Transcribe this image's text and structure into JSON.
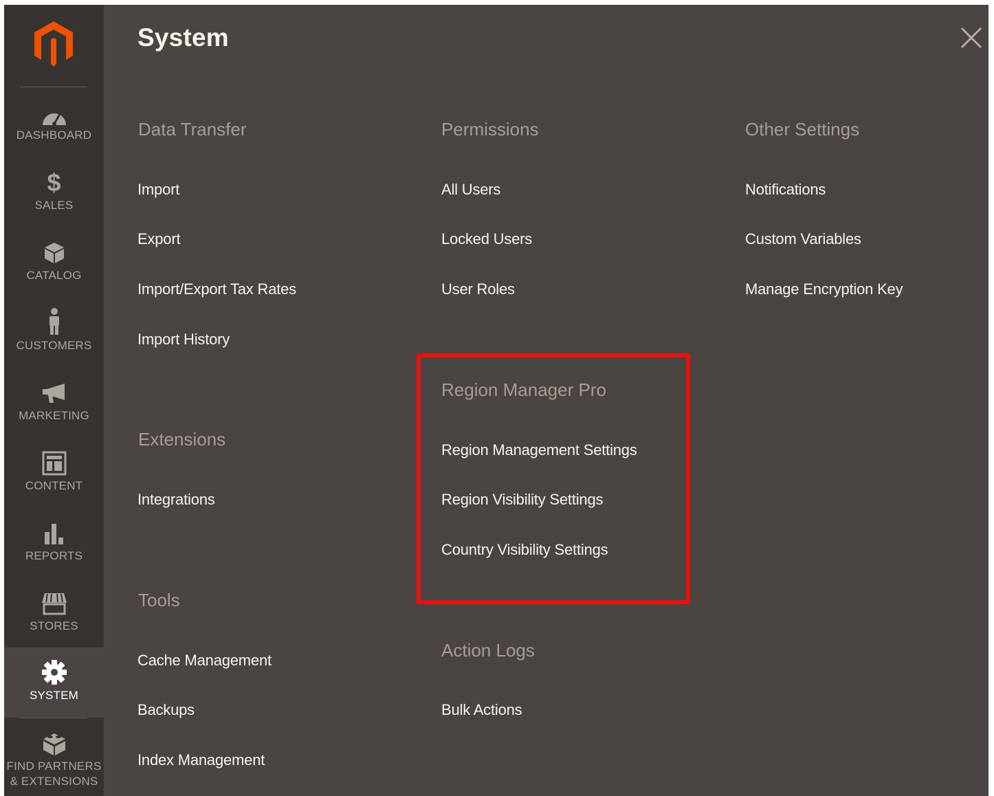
{
  "panel": {
    "title": "System",
    "close_icon": "close-icon"
  },
  "sidebar": {
    "items": [
      {
        "label": "DASHBOARD",
        "icon": "dashboard-icon",
        "active": false
      },
      {
        "label": "SALES",
        "icon": "dollar-icon",
        "active": false
      },
      {
        "label": "CATALOG",
        "icon": "box-icon",
        "active": false
      },
      {
        "label": "CUSTOMERS",
        "icon": "person-icon",
        "active": false
      },
      {
        "label": "MARKETING",
        "icon": "megaphone-icon",
        "active": false
      },
      {
        "label": "CONTENT",
        "icon": "layout-icon",
        "active": false
      },
      {
        "label": "REPORTS",
        "icon": "bar-chart-icon",
        "active": false
      },
      {
        "label": "STORES",
        "icon": "storefront-icon",
        "active": false
      },
      {
        "label": "SYSTEM",
        "icon": "gear-icon",
        "active": true
      },
      {
        "label": "FIND PARTNERS",
        "label2": "& EXTENSIONS",
        "icon": "blocks-icon",
        "active": false
      }
    ]
  },
  "sections": {
    "data_transfer": {
      "title": "Data Transfer",
      "links": [
        "Import",
        "Export",
        "Import/Export Tax Rates",
        "Import History"
      ]
    },
    "extensions": {
      "title": "Extensions",
      "links": [
        "Integrations"
      ]
    },
    "tools": {
      "title": "Tools",
      "links": [
        "Cache Management",
        "Backups",
        "Index Management"
      ]
    },
    "permissions": {
      "title": "Permissions",
      "links": [
        "All Users",
        "Locked Users",
        "User Roles"
      ]
    },
    "region_manager_pro": {
      "title": "Region Manager Pro",
      "links": [
        "Region Management Settings",
        "Region Visibility Settings",
        "Country Visibility Settings"
      ]
    },
    "action_logs": {
      "title": "Action Logs",
      "links": [
        "Bulk Actions"
      ]
    },
    "other_settings": {
      "title": "Other Settings",
      "links": [
        "Notifications",
        "Custom Variables",
        "Manage Encryption Key"
      ]
    }
  },
  "colors": {
    "highlight": "#e8120c",
    "accent": "#eb5202",
    "panel_bg": "#4a4542",
    "sidebar_bg": "#373330"
  }
}
